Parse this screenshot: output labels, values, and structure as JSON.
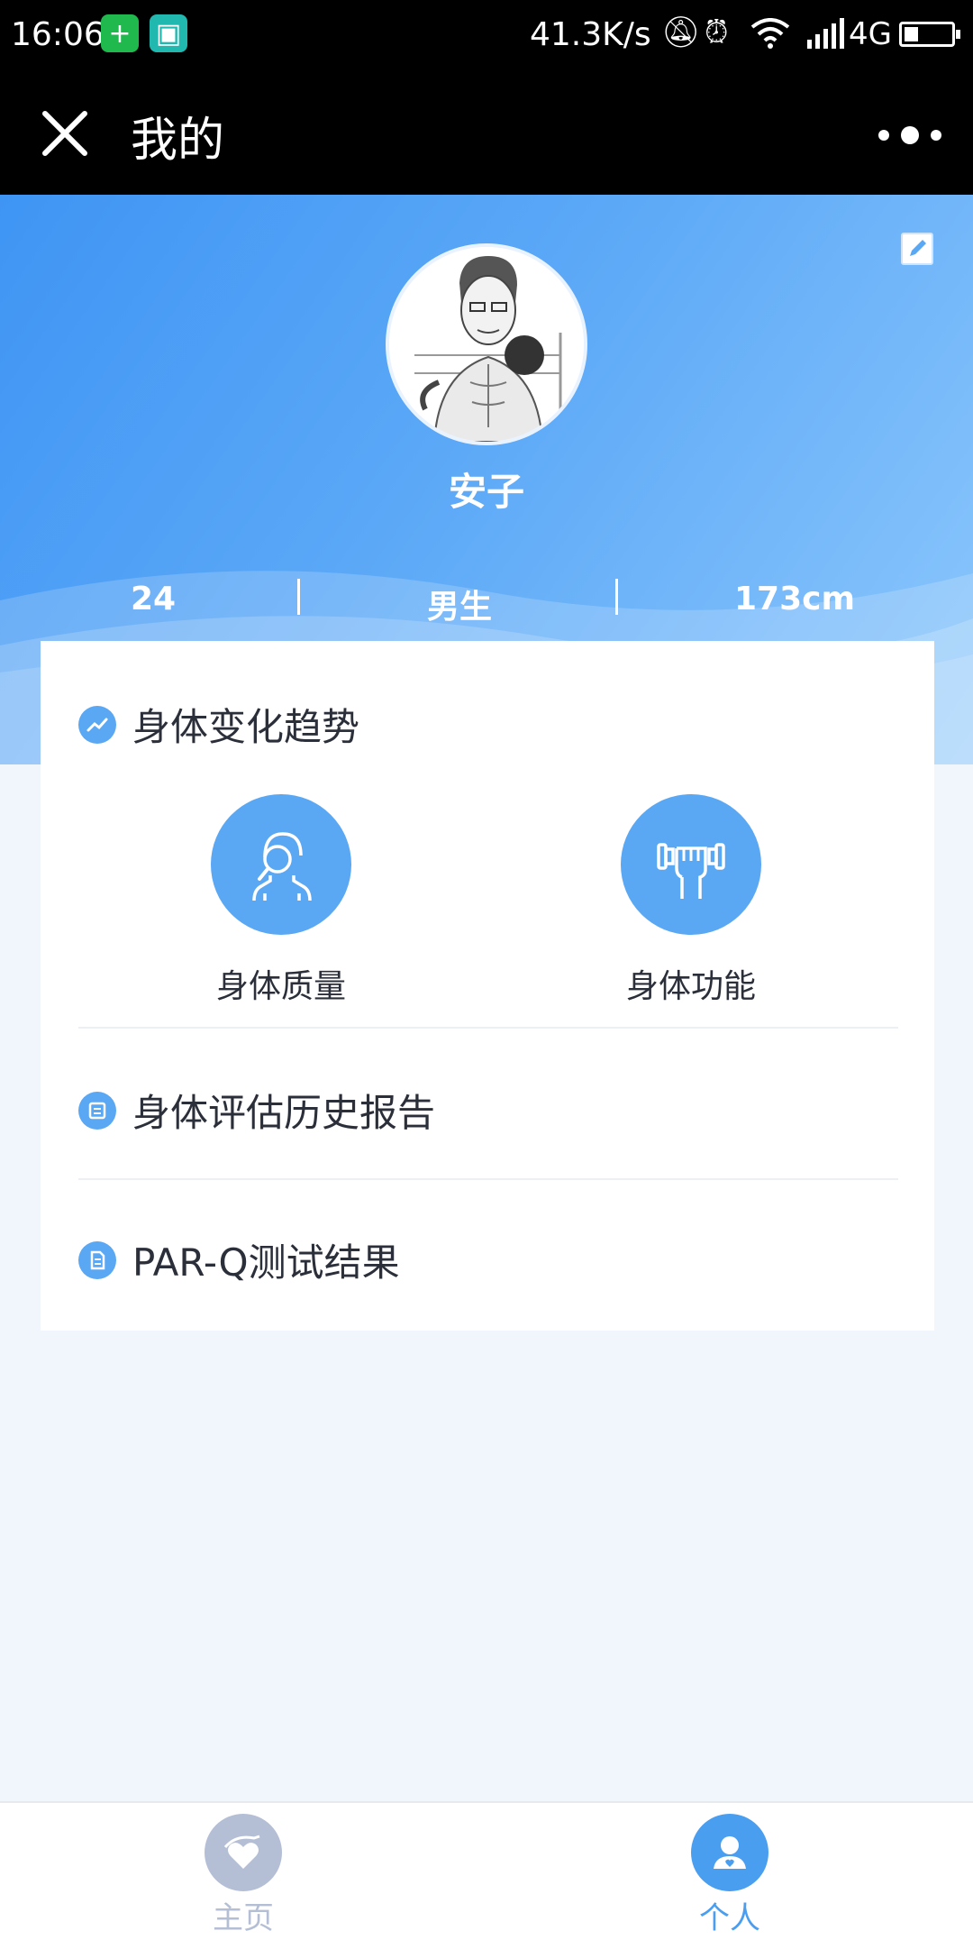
{
  "status_bar": {
    "time": "16:06",
    "speed": "41.3K/s",
    "network": "4G",
    "battery_level": 0.3,
    "icons": [
      "green-app-icon",
      "scan-app-icon",
      "bell-muted-icon",
      "alarm-icon",
      "wifi-icon",
      "signal-icon",
      "battery-icon"
    ]
  },
  "title_bar": {
    "title": "我的",
    "close_icon": "close-icon",
    "more_icon": "more-icon"
  },
  "profile": {
    "name": "安子",
    "age": "24",
    "gender": "男生",
    "height": "173cm"
  },
  "sections": {
    "trend": {
      "label": "身体变化趋势",
      "icon": "trend-icon"
    },
    "features": [
      {
        "label": "身体质量",
        "icon": "body-scan-icon"
      },
      {
        "label": "身体功能",
        "icon": "dumbbell-icon"
      }
    ],
    "history": {
      "label": "身体评估历史报告",
      "icon": "report-icon"
    },
    "parq": {
      "label": "PAR-Q测试结果",
      "icon": "document-icon"
    }
  },
  "bottom_nav": {
    "items": [
      {
        "label": "主页",
        "icon": "heart-hand-icon",
        "active": false
      },
      {
        "label": "个人",
        "icon": "person-icon",
        "active": true
      }
    ]
  },
  "colors": {
    "accent": "#5aa7f3",
    "header_start": "#3f95f4",
    "header_end": "#8cc7fc",
    "nav_inactive": "#b4bfd6",
    "nav_active": "#4a9ef0"
  }
}
